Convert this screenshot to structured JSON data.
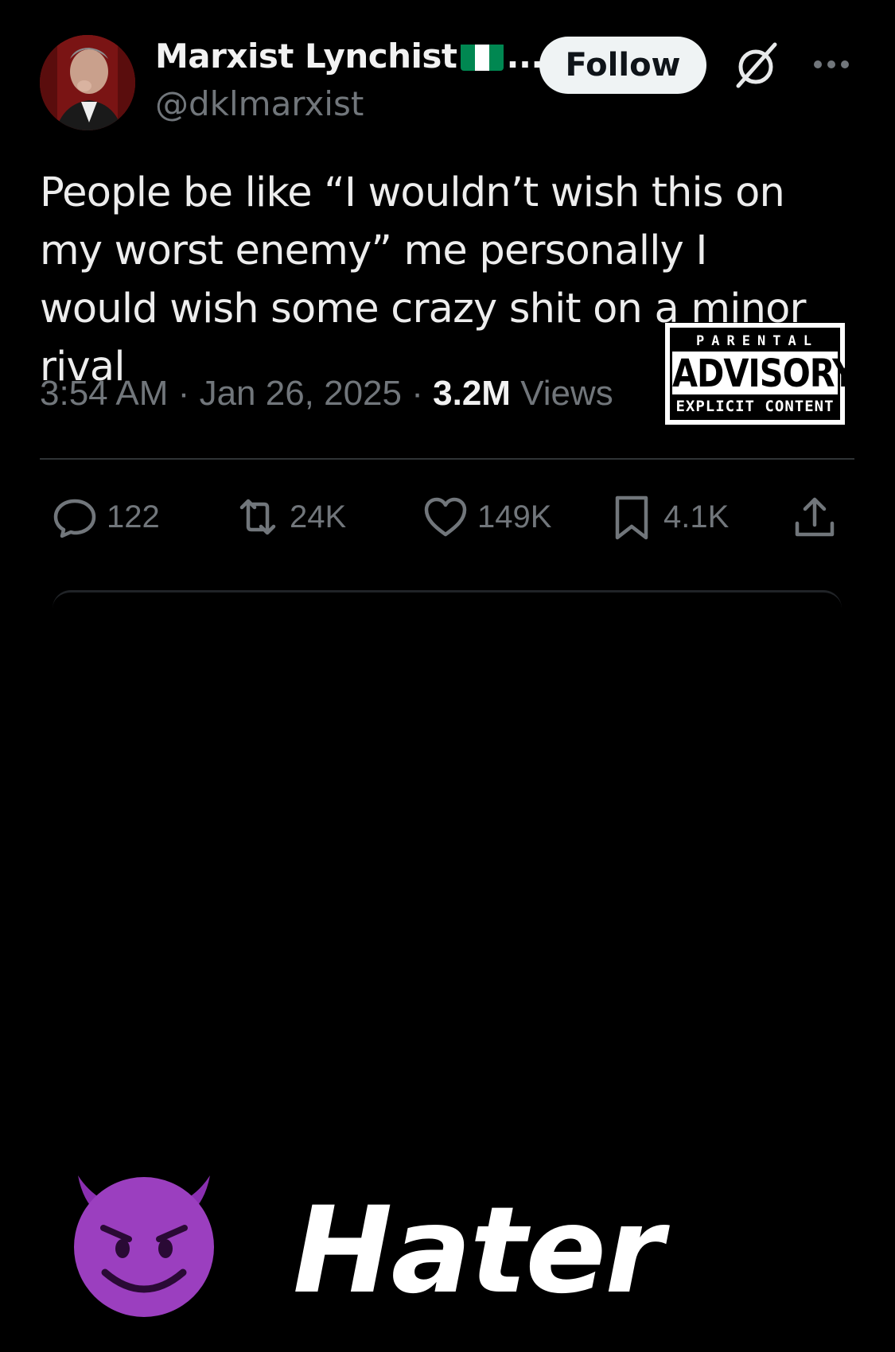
{
  "author": {
    "display_name": "Marxist Lynchist",
    "name_truncation": "...",
    "flag_colors": [
      "#008751",
      "#ffffff",
      "#008751"
    ],
    "handle": "@dklmarxist"
  },
  "header": {
    "follow_label": "Follow",
    "grok_icon": "grok-icon",
    "more_icon": "more-icon"
  },
  "tweet": {
    "text": "People be like “I wouldn’t wish this on my worst enemy” me personally I would wish some crazy shit on a minor rival",
    "time": "3:54 AM",
    "separator": "·",
    "date": "Jan 26, 2025",
    "views_count": "3.2M",
    "views_label": "Views"
  },
  "advisory_label": {
    "top": "PARENTAL",
    "middle": "ADVISORY",
    "bottom": "EXPLICIT CONTENT"
  },
  "actions": {
    "replies": "122",
    "reposts": "24K",
    "likes": "149K",
    "bookmarks": "4.1K",
    "share_icon": "share-icon"
  },
  "overlay": {
    "emoji": "smiling-devil-icon",
    "caption": "Hater"
  },
  "colors": {
    "background": "#000000",
    "text": "#e7e9ea",
    "muted": "#71767b",
    "devil": "#9b3fbf"
  }
}
